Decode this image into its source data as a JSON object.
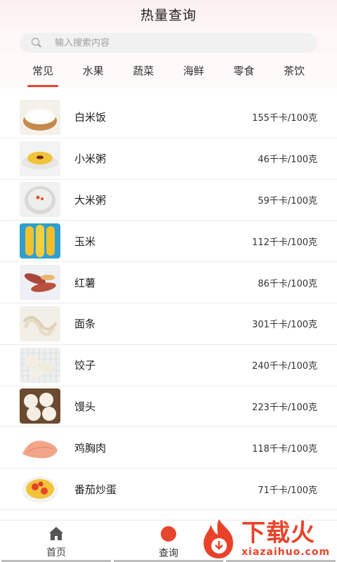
{
  "header": {
    "title": "热量查询"
  },
  "search": {
    "placeholder": "输入搜索内容"
  },
  "tabs": [
    {
      "label": "常见",
      "active": true
    },
    {
      "label": "水果"
    },
    {
      "label": "蔬菜"
    },
    {
      "label": "海鲜"
    },
    {
      "label": "零食"
    },
    {
      "label": "茶饮"
    }
  ],
  "foods": [
    {
      "name": "白米饭",
      "calories": "155千卡/100克",
      "icon": "rice-bowl-image"
    },
    {
      "name": "小米粥",
      "calories": "46千卡/100克",
      "icon": "millet-porridge-image"
    },
    {
      "name": "大米粥",
      "calories": "59千卡/100克",
      "icon": "rice-porridge-image"
    },
    {
      "name": "玉米",
      "calories": "112千卡/100克",
      "icon": "corn-image"
    },
    {
      "name": "红薯",
      "calories": "86千卡/100克",
      "icon": "sweet-potato-image"
    },
    {
      "name": "面条",
      "calories": "301千卡/100克",
      "icon": "noodles-image"
    },
    {
      "name": "饺子",
      "calories": "240千卡/100克",
      "icon": "dumplings-image"
    },
    {
      "name": "馒头",
      "calories": "223千卡/100克",
      "icon": "steamed-bun-image"
    },
    {
      "name": "鸡胸肉",
      "calories": "118千卡/100克",
      "icon": "chicken-breast-image"
    },
    {
      "name": "番茄炒蛋",
      "calories": "71千卡/100克",
      "icon": "tomato-egg-image"
    }
  ],
  "bottom_nav": [
    {
      "label": "首页",
      "icon": "home-icon"
    },
    {
      "label": "查询",
      "icon": "query-icon",
      "active": true
    }
  ],
  "watermark": {
    "cn": "下载火",
    "url": "xiazaihuo.com"
  },
  "colors": {
    "accent": "#e6452e",
    "watermark": "#e8432a"
  }
}
